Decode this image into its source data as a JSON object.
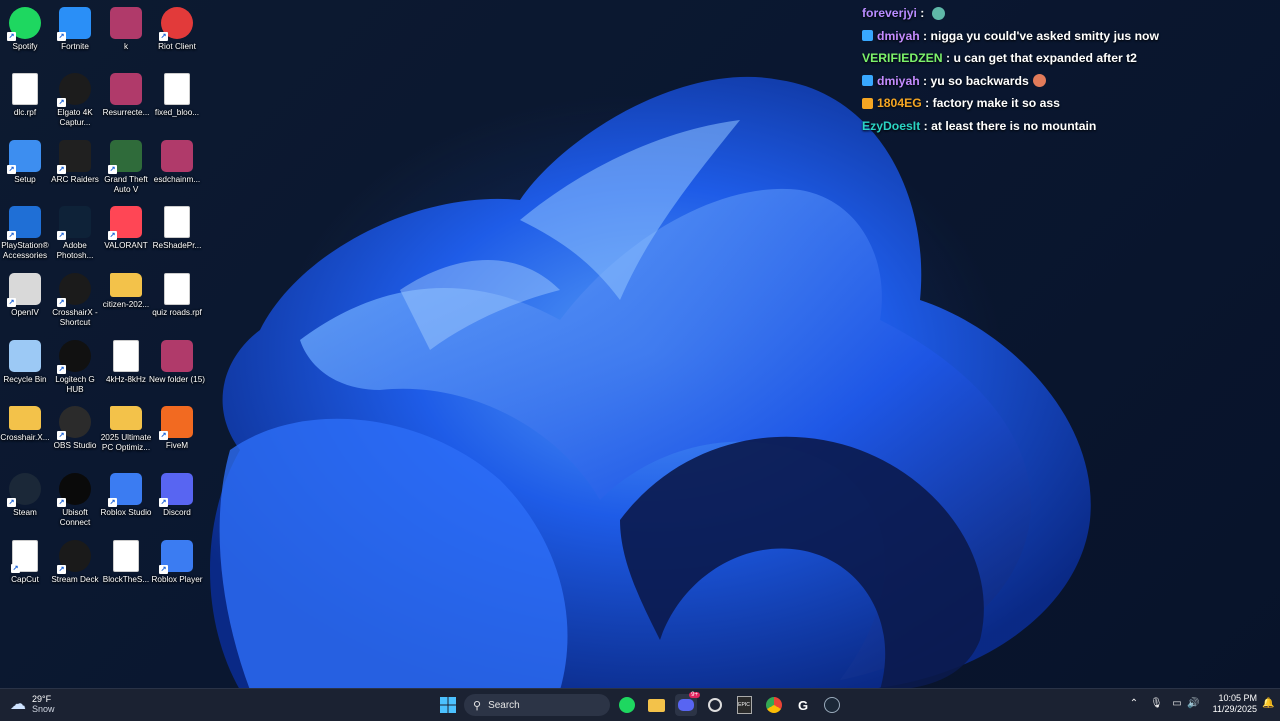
{
  "desktop_icons": [
    {
      "label": "Spotify",
      "icon": "spotify-icon",
      "color": "#1ed760"
    },
    {
      "label": "Fortnite",
      "icon": "fortnite-icon",
      "color": "#2a8ff7"
    },
    {
      "label": "k",
      "icon": "winrar-archive-icon",
      "color": "#b03a6a"
    },
    {
      "label": "Riot Client",
      "icon": "riot-client-icon",
      "color": "#e23a3a"
    },
    {
      "label": "dlc.rpf",
      "icon": "file-icon",
      "color": "#ffffff"
    },
    {
      "label": "Elgato 4K Captur...",
      "icon": "elgato-icon",
      "color": "#1c1c1c"
    },
    {
      "label": "Resurrecte...",
      "icon": "winrar-archive-icon",
      "color": "#b03a6a"
    },
    {
      "label": "fixed_bloo...",
      "icon": "file-icon",
      "color": "#ffffff"
    },
    {
      "label": "Setup",
      "icon": "setup-icon",
      "color": "#3d8ef0"
    },
    {
      "label": "ARC Raiders",
      "icon": "arc-raiders-icon",
      "color": "#202020"
    },
    {
      "label": "Grand Theft Auto V",
      "icon": "gta-v-icon",
      "color": "#2f6b3a"
    },
    {
      "label": "esdchainm...",
      "icon": "winrar-archive-icon",
      "color": "#b03a6a"
    },
    {
      "label": "PlayStation® Accessories",
      "icon": "playstation-icon",
      "color": "#1f6fd6"
    },
    {
      "label": "Adobe Photosh...",
      "icon": "photoshop-icon",
      "color": "#0e2238"
    },
    {
      "label": "VALORANT",
      "icon": "valorant-icon",
      "color": "#ff4655"
    },
    {
      "label": "ReShadePr...",
      "icon": "file-gear-icon",
      "color": "#ffffff"
    },
    {
      "label": "OpenIV",
      "icon": "openiv-icon",
      "color": "#d9d9d9"
    },
    {
      "label": "CrosshairX - Shortcut",
      "icon": "crosshairx-icon",
      "color": "#1b1b1b"
    },
    {
      "label": "citizen-202...",
      "icon": "folder-icon",
      "color": "#f3c24a"
    },
    {
      "label": "quiz roads.rpf",
      "icon": "file-icon",
      "color": "#ffffff"
    },
    {
      "label": "Recycle Bin",
      "icon": "recycle-bin-icon",
      "color": "#9cc9f5"
    },
    {
      "label": "Logitech G HUB",
      "icon": "logitech-icon",
      "color": "#111111"
    },
    {
      "label": "4kHz-8kHz",
      "icon": "file-gear-icon",
      "color": "#ffffff"
    },
    {
      "label": "New folder (15)",
      "icon": "winrar-archive-icon",
      "color": "#b03a6a"
    },
    {
      "label": "Crosshair.X...",
      "icon": "folder-icon",
      "color": "#f3c24a"
    },
    {
      "label": "OBS Studio",
      "icon": "obs-icon",
      "color": "#2b2b2b"
    },
    {
      "label": "2025 Ultimate PC Optimiz...",
      "icon": "folder-icon",
      "color": "#f3c24a"
    },
    {
      "label": "FiveM",
      "icon": "fivem-icon",
      "color": "#f26a21"
    },
    {
      "label": "Steam",
      "icon": "steam-icon",
      "color": "#1b2838"
    },
    {
      "label": "Ubisoft Connect",
      "icon": "ubisoft-icon",
      "color": "#0a0a0a"
    },
    {
      "label": "Roblox Studio",
      "icon": "roblox-studio-icon",
      "color": "#3b7cf2"
    },
    {
      "label": "Discord",
      "icon": "discord-icon",
      "color": "#5865f2"
    },
    {
      "label": "CapCut",
      "icon": "capcut-icon",
      "color": "#ffffff"
    },
    {
      "label": "Stream Deck",
      "icon": "stream-deck-icon",
      "color": "#1a1a1a"
    },
    {
      "label": "BlockTheS...",
      "icon": "file-gear-icon",
      "color": "#ffffff"
    },
    {
      "label": "Roblox Player",
      "icon": "roblox-player-icon",
      "color": "#3b7cf2"
    }
  ],
  "chat": [
    {
      "user": "foreverjyi",
      "user_color": "#b88cff",
      "message": "",
      "badge": "none",
      "emote": true
    },
    {
      "user": "dmiyah",
      "user_color": "#c48cff",
      "message": "nigga yu could've asked smitty jus now",
      "badge": "prime",
      "emote": false
    },
    {
      "user": "VERIFIEDZEN",
      "user_color": "#7cf26b",
      "message": "u can get that expanded after t2",
      "badge": "none",
      "emote": false
    },
    {
      "user": "dmiyah",
      "user_color": "#c48cff",
      "message": "yu so backwards",
      "badge": "prime",
      "emote": true
    },
    {
      "user": "1804EG",
      "user_color": "#f5a623",
      "message": "factory make it so ass",
      "badge": "sub",
      "emote": false
    },
    {
      "user": "EzyDoesIt",
      "user_color": "#2bd4c4",
      "message": "at least there is no mountain",
      "badge": "none",
      "emote": false
    }
  ],
  "taskbar": {
    "weather_temp": "29°F",
    "weather_desc": "Snow",
    "search_placeholder": "Search",
    "time": "10:05 PM",
    "date": "11/29/2025",
    "discord_badge": "9+",
    "pinned": [
      "start-icon",
      "search-icon",
      "spotify-icon",
      "file-explorer-icon",
      "discord-icon",
      "app-icon",
      "epic-games-icon",
      "chrome-icon",
      "logitech-icon",
      "steam-icon"
    ]
  }
}
